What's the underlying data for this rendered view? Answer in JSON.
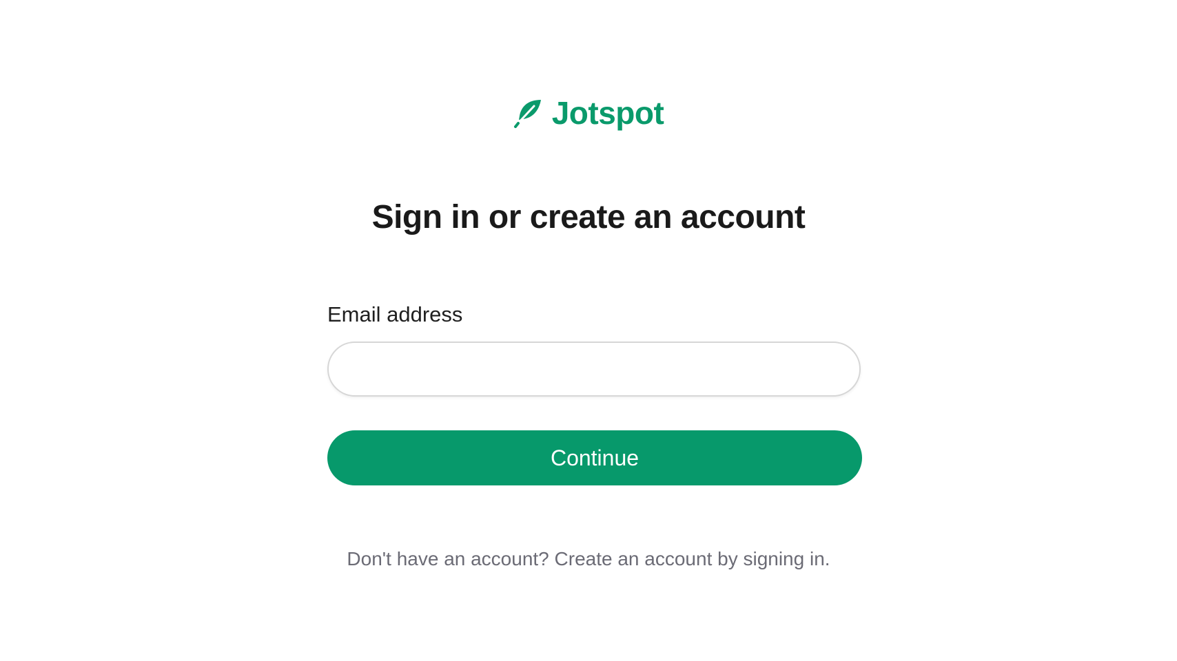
{
  "brand": {
    "name": "Jotspot",
    "icon": "feather-icon",
    "color": "#0a9a6b"
  },
  "heading": "Sign in or create an account",
  "form": {
    "email_label": "Email address",
    "email_value": "",
    "email_placeholder": "",
    "continue_label": "Continue",
    "button_color": "#07996b"
  },
  "footer": {
    "hint": "Don't have an account? Create an account by signing in."
  }
}
